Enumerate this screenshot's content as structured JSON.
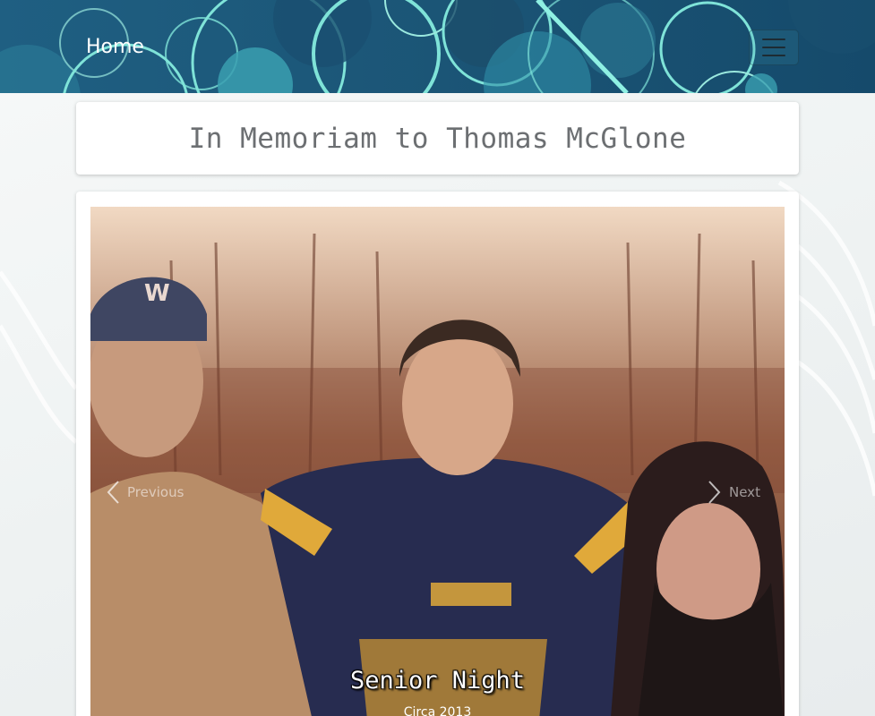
{
  "navbar": {
    "brand_label": "Home",
    "toggler_icon": "hamburger-icon"
  },
  "page": {
    "title": "In Memoriam to Thomas McGlone"
  },
  "carousel": {
    "prev_label": "Previous",
    "next_label": "Next",
    "prev_icon": "chevron-left-icon",
    "next_icon": "chevron-right-icon",
    "slide": {
      "caption_title": "Senior Night",
      "caption_subtitle": "Circa 2013"
    }
  },
  "colors": {
    "navbar_bg": "#1b5576",
    "bubble_accent": "#7fe3d8",
    "card_bg": "#ffffff",
    "title_text": "#6c6f72"
  }
}
